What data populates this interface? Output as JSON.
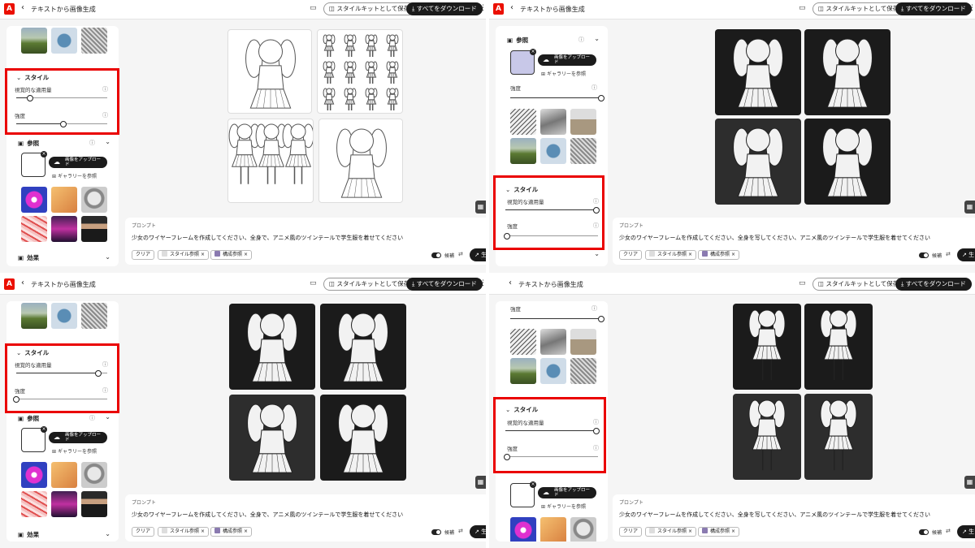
{
  "app": {
    "title": "テキストから画像生成",
    "logo": "A",
    "back_icon": "‹",
    "save_label": "スタイルキットとして保存",
    "download_label": "すべてをダウンロード",
    "download_icon": "⤓",
    "save_icon": "◫",
    "chat_icon": "▭",
    "apps_icon": "⋮⋮",
    "brand_color": "#eb1000",
    "highlight_color": "#ea0000"
  },
  "sidebar": {
    "style_header": "スタイル",
    "visual_label": "視覚的な適用量",
    "strength_label": "強度",
    "reference_label": "参照",
    "reference_icon": "▣",
    "effects_label": "効果",
    "upload_label": "画像をアップロード",
    "gallery_label": "ギャラリーを参照",
    "info_icon": "ⓘ",
    "chevron_icon": "⌄",
    "collapse_icon": "⌄",
    "close_icon": "×",
    "cloud_icon": "☁",
    "gallery_icon": "⊞"
  },
  "prompt": {
    "label": "プロンプト",
    "clear_label": "クリア",
    "style_ref_label": "スタイル参照",
    "structure_ref_label": "構成参照",
    "chip_close": "×",
    "candidate_label": "候補",
    "candidate_icon": "⇄",
    "generate_label": "生",
    "generate_icon": "↗",
    "grid_icon": "▦"
  },
  "panels": [
    {
      "prompt_text": "少女のワイヤーフレームを作成してください、全身で、アニメ風のツインテールで学生服を着せてください",
      "visual_amount": 0.15,
      "strength": 0.52,
      "image_theme": "wireframe"
    },
    {
      "prompt_text": "少女のワイヤーフレームを作成してください、全身を写してください、アニメ風のツインテールで学生服を着せてください",
      "visual_amount": 1.0,
      "strength": 0.0,
      "image_theme": "dark-portrait"
    },
    {
      "prompt_text": "少女のワイヤーフレームを作成してください、全身で、アニメ風のツインテールで学生服を着せてください",
      "visual_amount": 0.9,
      "strength": 0.0,
      "image_theme": "dark-portrait"
    },
    {
      "prompt_text": "少女のワイヤーフレームを作成してください、全身を写してください、アニメ風のツインテールで学生服を着せてください",
      "visual_amount": 1.0,
      "strength": 0.0,
      "image_theme": "dark-fullbody"
    }
  ]
}
